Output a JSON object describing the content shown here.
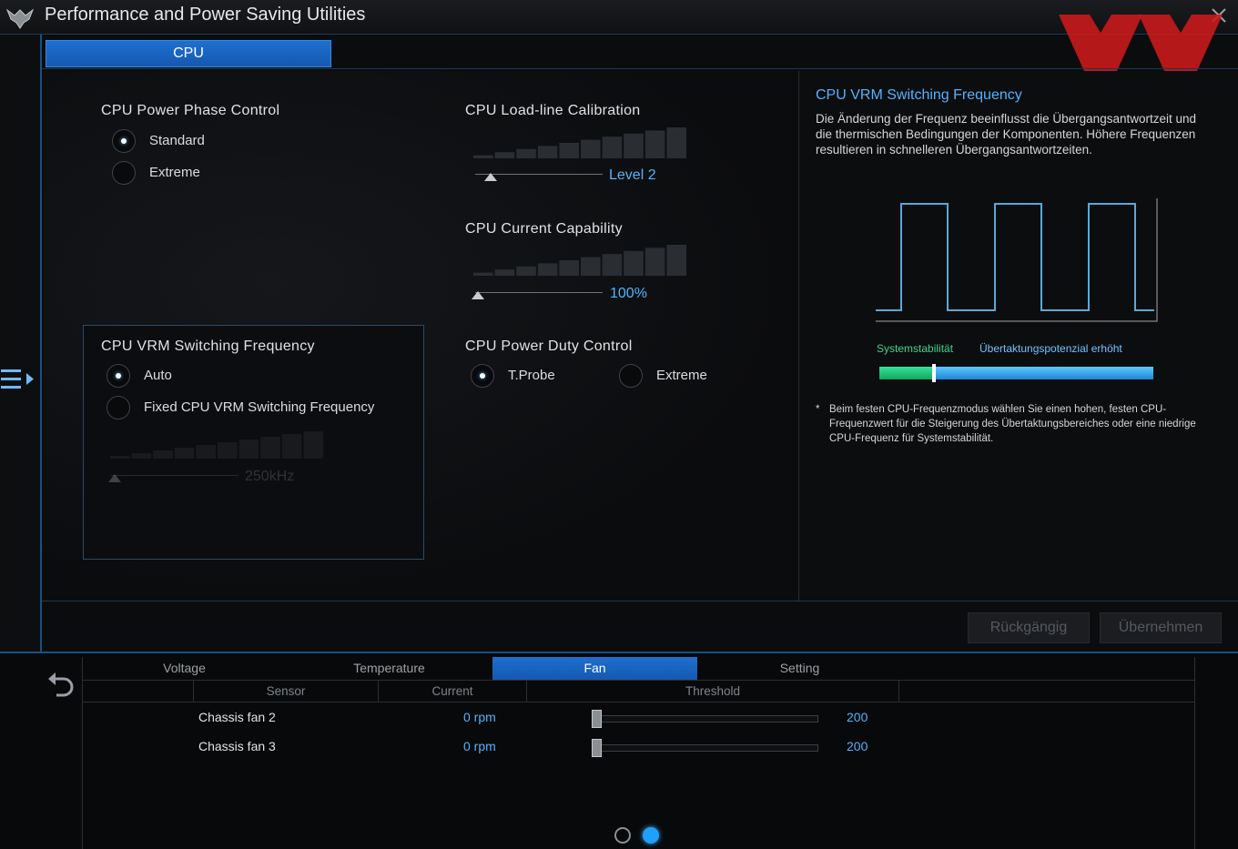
{
  "app": {
    "title": "Performance and Power Saving Utilities",
    "logo_icon": "tuf-logo-icon",
    "close_icon": "close-icon",
    "watermark_icon": "red-xx-watermark-icon"
  },
  "tabs": {
    "cpu": "CPU"
  },
  "phase_control": {
    "label": "CPU Power Phase Control",
    "options": [
      "Standard",
      "Extreme"
    ],
    "selected": "Standard"
  },
  "loadline": {
    "label": "CPU Load-line Calibration",
    "value": "Level 2",
    "level_fraction": 0.12
  },
  "current_capability": {
    "label": "CPU Current Capability",
    "value": "100%",
    "level_fraction": 0.02
  },
  "vrm_switching": {
    "label": "CPU VRM Switching Frequency",
    "options": [
      "Auto",
      "Fixed CPU VRM Switching Frequency"
    ],
    "selected": "Auto",
    "fixed_value": "250kHz"
  },
  "duty_control": {
    "label": "CPU Power Duty Control",
    "options": [
      "T.Probe",
      "Extreme"
    ],
    "selected": "T.Probe"
  },
  "info": {
    "title": "CPU VRM Switching Frequency",
    "text": "Die Änderung der Frequenz beeinflusst die Übergangsantwortzeit und die thermischen Bedingungen der Komponenten. Höhere Frequenzen resultieren in schnelleren Übergangsantwortzeiten.",
    "stability_label": "Systemstabilität",
    "overclock_label": "Übertaktungspotenzial erhöht",
    "stability_level": 0.2,
    "footnote_star": "*",
    "footnote": "Beim festen CPU-Frequenzmodus wählen Sie einen hohen, festen CPU-Frequenzwert für die Steigerung des Übertaktungsbereiches oder eine niedrige CPU-Frequenz für Systemstabilität."
  },
  "buttons": {
    "undo": "Rückgängig",
    "apply": "Übernehmen"
  },
  "monitor": {
    "tabs": [
      "Voltage",
      "Temperature",
      "Fan",
      "Setting"
    ],
    "active_tab": "Fan",
    "columns": [
      "Sensor",
      "Current",
      "Threshold"
    ],
    "rows": [
      {
        "sensor": "Chassis fan 2",
        "current": "0 rpm",
        "threshold": "200"
      },
      {
        "sensor": "Chassis fan 3",
        "current": "0 rpm",
        "threshold": "200"
      }
    ],
    "page_count": 2,
    "active_page": 2
  },
  "colors": {
    "accent_blue": "#52b3ff",
    "tab_blue": "#1f6fcf",
    "stability_green": "#3fd48a",
    "watermark_red": "#cc1a1a"
  }
}
